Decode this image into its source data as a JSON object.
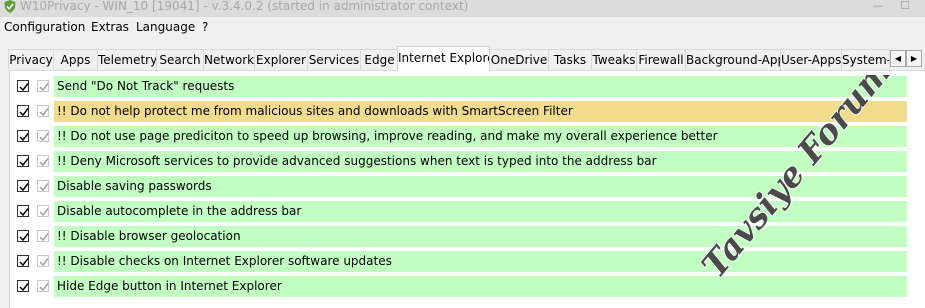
{
  "window": {
    "title": "W10Privacy - WIN_10 [19041] - v.3.4.0.2 (started in administrator context)",
    "controls": {
      "minimize": "—",
      "maximize": "☐"
    }
  },
  "menu": [
    "Configuration",
    "Extras",
    "Language",
    "?"
  ],
  "tabs": [
    "Privacy",
    "Apps",
    "Telemetry",
    "Search",
    "Network",
    "Explorer",
    "Services",
    "Edge",
    "Internet Explorer",
    "OneDrive",
    "Tasks",
    "Tweaks",
    "Firewall",
    "Background-Apps",
    "User-Apps",
    "System-A"
  ],
  "active_tab": "Internet Explorer",
  "tab_scroll": {
    "left": "◀",
    "right": "▶"
  },
  "settings": [
    {
      "label": "Send \"Do Not Track\" requests",
      "checked": true,
      "recommended": true,
      "status": "recommended"
    },
    {
      "label": "!! Do not help protect me from malicious sites and downloads with SmartScreen Filter",
      "checked": true,
      "recommended": true,
      "status": "conditional"
    },
    {
      "label": "!! Do not use page prediciton to speed up browsing, improve reading, and make my overall experience better",
      "checked": true,
      "recommended": true,
      "status": "recommended"
    },
    {
      "label": "!! Deny Microsoft services to provide advanced suggestions when text is typed into the address bar",
      "checked": true,
      "recommended": true,
      "status": "recommended"
    },
    {
      "label": "Disable saving passwords",
      "checked": true,
      "recommended": true,
      "status": "recommended"
    },
    {
      "label": "Disable autocomplete in the address bar",
      "checked": true,
      "recommended": true,
      "status": "recommended"
    },
    {
      "label": "!! Disable browser geolocation",
      "checked": true,
      "recommended": true,
      "status": "recommended"
    },
    {
      "label": "!! Disable checks on Internet Explorer software updates",
      "checked": true,
      "recommended": true,
      "status": "recommended"
    },
    {
      "label": "Hide Edge button in Internet Explorer",
      "checked": true,
      "recommended": true,
      "status": "recommended"
    }
  ],
  "colors": {
    "recommended_row": "#c2ffc2",
    "conditional_row": "#f0dc8c",
    "watermark": "#4a4a4a"
  },
  "watermark": {
    "text": "Tavsiye Forumu"
  }
}
